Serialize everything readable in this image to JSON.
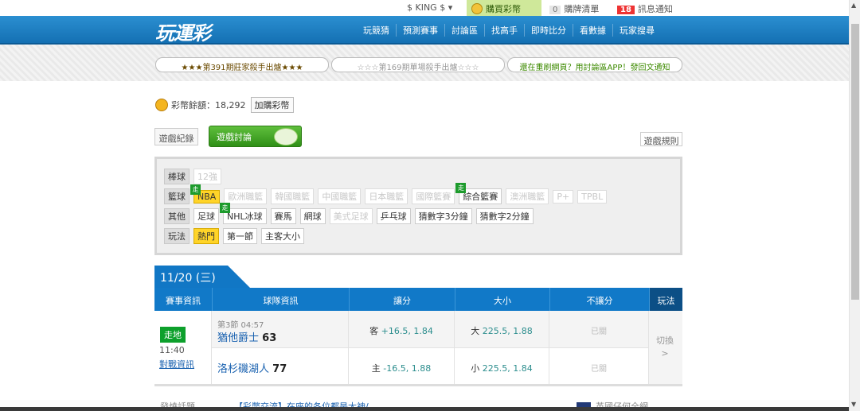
{
  "userbar": {
    "king_coin": "$ KING $",
    "buy_coin": "購買彩幣",
    "cart_count": "0",
    "cart_label": "購牌清單",
    "msg_count": "18",
    "msg_label": "訊息通知"
  },
  "header": {
    "logo": "玩運彩",
    "nav": [
      "玩競猜",
      "預測賽事",
      "討論區",
      "找高手",
      "即時比分",
      "看數據",
      "玩家搜尋"
    ]
  },
  "news": [
    "★★★第391期莊家殺手出爐★★★",
    "☆☆☆第169期單場殺手出爐☆☆☆",
    "還在重刷網頁？用討論區APP！發回文通知"
  ],
  "balance": {
    "label": "彩幣餘額：",
    "amount": "18,292",
    "buy_button": "加購彩幣"
  },
  "tabs": {
    "record": "遊戲紀錄",
    "discuss": "遊戲討論",
    "rules": "遊戲規則"
  },
  "filters": {
    "baseball": {
      "label": "棒球",
      "chips": [
        "12強"
      ]
    },
    "basketball": {
      "label": "籃球",
      "chips": [
        "NBA",
        "歐洲職籃",
        "韓國職籃",
        "中國職籃",
        "日本職籃",
        "國際籃賽",
        "綜合籃賽",
        "澳洲職籃",
        "P+",
        "TPBL"
      ]
    },
    "other": {
      "label": "其他",
      "chips": [
        "足球",
        "NHL冰球",
        "賽馬",
        "網球",
        "美式足球",
        "乒乓球",
        "猜數字3分鐘",
        "猜數字2分鐘"
      ]
    },
    "play": {
      "label": "玩法",
      "chips": [
        "熱門",
        "第一節",
        "主客大小"
      ]
    },
    "badge": "走"
  },
  "date_tab": "11/20 (三)",
  "table": {
    "headers": [
      "賽事資訊",
      "球隊資訊",
      "讓分",
      "大小",
      "不讓分",
      "玩法"
    ],
    "game": {
      "status": "走地",
      "time": "11:40",
      "analysis": "對戰資訊",
      "quarter": "第3節 04:57",
      "away_team": "猶他爵士",
      "away_score": "63",
      "home_team": "洛杉磯湖人",
      "home_score": "77",
      "spread_away_label": "客",
      "spread_away": "+16.5, 1.84",
      "spread_home_label": "主",
      "spread_home": "-16.5, 1.88",
      "total_over_label": "大",
      "total_over": "225.5, 1.88",
      "total_under_label": "小",
      "total_under": "225.5, 1.84",
      "moneyline_away": "已關",
      "moneyline_home": "已關",
      "switch": "切換"
    }
  },
  "bottom": {
    "label": "發燒話題",
    "topic": "【彩幣交流】在座的各位都是大神/",
    "right": "英國仔何全網"
  }
}
